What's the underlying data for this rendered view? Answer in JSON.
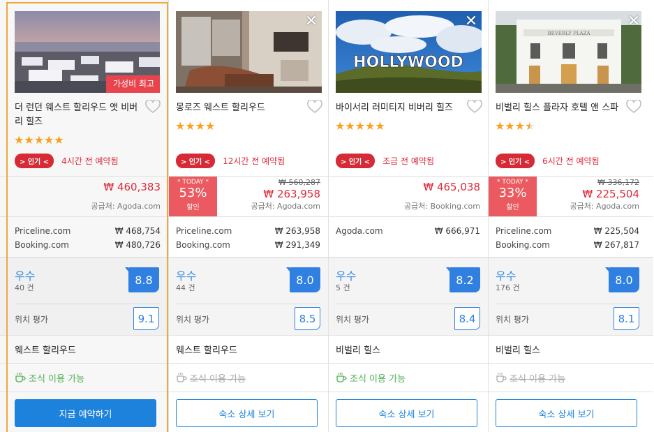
{
  "currency": "₩",
  "hotels": [
    {
      "name": "더 런던 웨스트 할리우드 앳 비버리 힐즈",
      "badge": "가성비 최고",
      "stars": "★★★★★",
      "popular_tag": "> 인기 <",
      "popular_text": "4시간 전 예약됨",
      "price": "₩ 460,383",
      "supplier": "공급처: Agoda.com",
      "rates": [
        {
          "site": "Priceline.com",
          "price": "₩  468,754"
        },
        {
          "site": "Booking.com",
          "price": "₩  480,726"
        }
      ],
      "rating_word": "우수",
      "review_count": "40 건",
      "score": "8.8",
      "location_label": "위치 평가",
      "location_score": "9.1",
      "area": "웨스트 할리우드",
      "breakfast": "조식 이용 가능",
      "cta": "지금 예약하기"
    },
    {
      "name": "몽로즈 웨스트 할리우드",
      "stars": "★★★★",
      "popular_tag": "> 인기 <",
      "popular_text": "12시간 전 예약됨",
      "deal_label": "* TODAY *",
      "deal_pct": "53%",
      "deal_sub": "할인",
      "original_price": "₩ 560,287",
      "price": "₩ 263,958",
      "supplier": "공급처: Agoda.com",
      "rates": [
        {
          "site": "Priceline.com",
          "price": "₩  263,958"
        },
        {
          "site": "Booking.com",
          "price": "₩  291,349"
        }
      ],
      "rating_word": "우수",
      "review_count": "44 건",
      "score": "8.0",
      "location_label": "위치 평가",
      "location_score": "8.5",
      "area": "웨스트 할리우드",
      "breakfast": "조식 이용 가능",
      "cta": "숙소 상세 보기"
    },
    {
      "name": "바이서리 러미티지 비버리 힐즈",
      "stars": "★★★★★",
      "popular_tag": "> 인기 <",
      "popular_text": "조금 전 예약됨",
      "price": "₩ 465,038",
      "supplier": "공급처: Booking.com",
      "rates": [
        {
          "site": "Agoda.com",
          "price": "₩  666,971"
        }
      ],
      "rating_word": "우수",
      "review_count": "5 건",
      "score": "8.2",
      "location_label": "위치 평가",
      "location_score": "8.4",
      "area": "비벌리 힐스",
      "breakfast": "조식 이용 가능",
      "cta": "숙소 상세 보기",
      "photo_text": "HOLLYWOOD"
    },
    {
      "name": "비벌리 힐스 플라자 호텔 앤 스파",
      "stars": "★★★",
      "popular_tag": "> 인기 <",
      "popular_text": "6시간 전 예약됨",
      "deal_label": "* TODAY *",
      "deal_pct": "33%",
      "deal_sub": "할인",
      "original_price": "₩ 336,172",
      "price": "₩ 225,504",
      "supplier": "공급처: Agoda.com",
      "rates": [
        {
          "site": "Priceline.com",
          "price": "₩  225,504"
        },
        {
          "site": "Booking.com",
          "price": "₩  267,817"
        }
      ],
      "rating_word": "우수",
      "review_count": "176 건",
      "score": "8.0",
      "location_label": "위치 평가",
      "location_score": "8.1",
      "area": "비벌리 힐스",
      "breakfast": "조식 이용 가능",
      "cta": "숙소 상세 보기",
      "photo_text": "BEVERLY PLAZA"
    }
  ],
  "colors": {
    "accent": "#1c82dc",
    "price_red": "#e0283a",
    "deal_bg": "#ea5a60",
    "star": "#f9a020",
    "featured_outline": "#f0a83c",
    "breakfast_green": "#4caf50"
  }
}
